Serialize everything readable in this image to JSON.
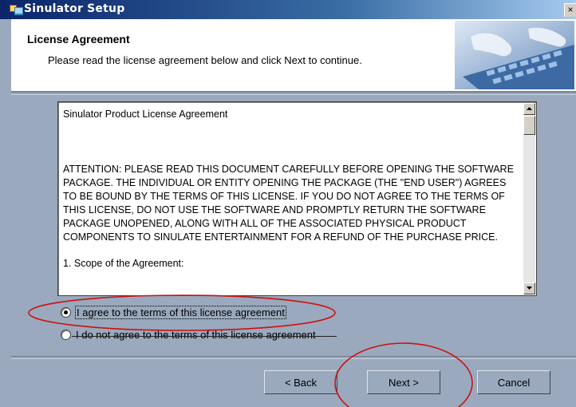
{
  "window": {
    "title": "Sinulator Setup",
    "close_glyph": "×",
    "icon": "setup-app-icon"
  },
  "header": {
    "title": "License Agreement",
    "subtitle": "Please read the license agreement below and click Next to continue.",
    "image": "typing-hands-image"
  },
  "license": {
    "paragraphs": [
      "Sinulator Product License Agreement",
      "ATTENTION: PLEASE READ THIS DOCUMENT CAREFULLY BEFORE OPENING THE SOFTWARE PACKAGE. THE INDIVIDUAL OR ENTITY OPENING THE PACKAGE (THE \"END USER\") AGREES TO BE BOUND BY THE TERMS OF THIS LICENSE. IF YOU DO NOT AGREE TO THE TERMS OF THIS LICENSE, DO NOT USE THE SOFTWARE AND PROMPTLY RETURN THE SOFTWARE PACKAGE UNOPENED, ALONG WITH ALL OF THE ASSOCIATED PHYSICAL PRODUCT COMPONENTS TO SINULATE ENTERTAINMENT FOR A REFUND OF THE PURCHASE PRICE.",
      "1.  Scope of the Agreement:"
    ]
  },
  "options": {
    "agree_label": "I agree to the terms of this license agreement",
    "disagree_label": "I do not agree to the terms of this license agreement",
    "selected": "agree"
  },
  "buttons": {
    "back": "< Back",
    "next": "Next >",
    "cancel": "Cancel"
  },
  "colors": {
    "dialog_background": "#9aa9bd",
    "annotation_circle": "#cc1111",
    "titlebar_start": "#0a246a"
  }
}
